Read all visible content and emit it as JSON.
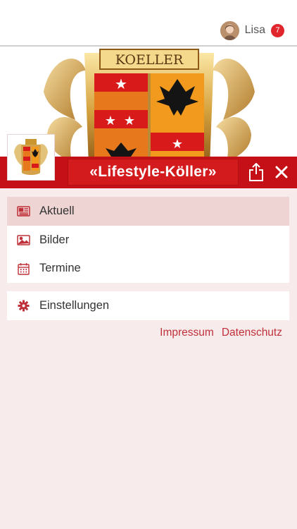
{
  "header": {
    "user_name": "Lisa",
    "notification_count": "7"
  },
  "banner": {
    "crest_text": "KOELLER"
  },
  "titlebar": {
    "title": "«Lifestyle-Köller»"
  },
  "menu": {
    "items": [
      {
        "label": "Aktuell",
        "icon": "newspaper-icon",
        "active": true
      },
      {
        "label": "Bilder",
        "icon": "image-icon",
        "active": false
      },
      {
        "label": "Termine",
        "icon": "calendar-icon",
        "active": false
      }
    ],
    "settings": {
      "label": "Einstellungen",
      "icon": "gear-icon"
    }
  },
  "footer": {
    "impressum": "Impressum",
    "datenschutz": "Datenschutz"
  },
  "colors": {
    "brand_red": "#c41016",
    "background": "#f8ebeb",
    "active_item": "#efd4d4",
    "link": "#c0303a",
    "badge": "#e0262c"
  }
}
